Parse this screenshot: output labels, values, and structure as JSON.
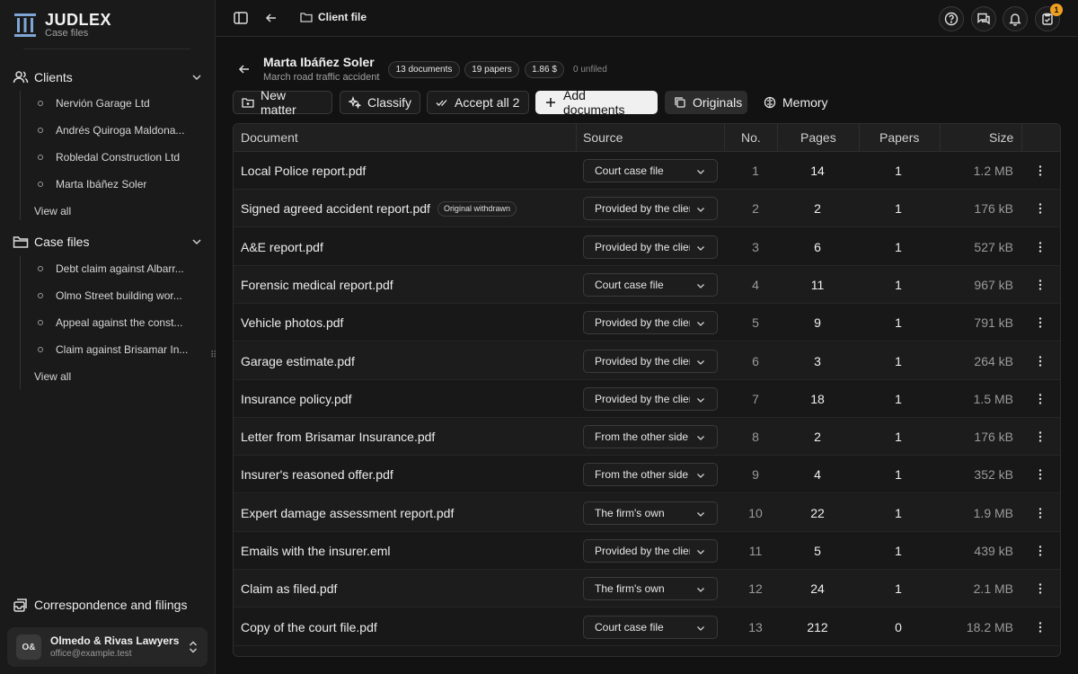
{
  "brand": {
    "title": "JUDLEX",
    "subtitle": "Case files"
  },
  "sidebar": {
    "clients": {
      "label": "Clients",
      "items": [
        "Nervión Garage Ltd",
        "Andrés Quiroga Maldona...",
        "Robledal Construction Ltd",
        "Marta Ibáñez Soler"
      ],
      "view_all": "View all"
    },
    "case_files": {
      "label": "Case files",
      "items": [
        "Debt claim against Albarr...",
        "Olmo Street building wor...",
        "Appeal against the const...",
        "Claim against Brisamar In..."
      ],
      "view_all": "View all"
    },
    "correspondence": "Correspondence and filings",
    "account": {
      "initials": "O&",
      "name": "Olmedo & Rivas Lawyers",
      "email": "office@example.test"
    }
  },
  "topbar": {
    "breadcrumb": "Client file",
    "notification_count": "1"
  },
  "client": {
    "name": "Marta Ibáñez Soler",
    "subtitle": "March road traffic accident",
    "pills": [
      "13 documents",
      "19 papers",
      "1.86 $"
    ],
    "unfiled": "0 unfiled"
  },
  "actions": {
    "new_matter": "New matter",
    "classify": "Classify",
    "accept_all": "Accept all 2",
    "add_documents": "Add documents",
    "originals": "Originals",
    "memory": "Memory"
  },
  "table": {
    "headers": {
      "document": "Document",
      "source": "Source",
      "no": "No.",
      "pages": "Pages",
      "papers": "Papers",
      "size": "Size"
    },
    "rows": [
      {
        "document": "Local Police report.pdf",
        "tag": "",
        "source": "Court case file",
        "no": "1",
        "pages": "14",
        "papers": "1",
        "size": "1.2 MB"
      },
      {
        "document": "Signed agreed accident report.pdf",
        "tag": "Original withdrawn",
        "source": "Provided by the client",
        "no": "2",
        "pages": "2",
        "papers": "1",
        "size": "176 kB"
      },
      {
        "document": "A&E report.pdf",
        "tag": "",
        "source": "Provided by the client",
        "no": "3",
        "pages": "6",
        "papers": "1",
        "size": "527 kB"
      },
      {
        "document": "Forensic medical report.pdf",
        "tag": "",
        "source": "Court case file",
        "no": "4",
        "pages": "11",
        "papers": "1",
        "size": "967 kB"
      },
      {
        "document": "Vehicle photos.pdf",
        "tag": "",
        "source": "Provided by the client",
        "no": "5",
        "pages": "9",
        "papers": "1",
        "size": "791 kB"
      },
      {
        "document": "Garage estimate.pdf",
        "tag": "",
        "source": "Provided by the client",
        "no": "6",
        "pages": "3",
        "papers": "1",
        "size": "264 kB"
      },
      {
        "document": "Insurance policy.pdf",
        "tag": "",
        "source": "Provided by the client",
        "no": "7",
        "pages": "18",
        "papers": "1",
        "size": "1.5 MB"
      },
      {
        "document": "Letter from Brisamar Insurance.pdf",
        "tag": "",
        "source": "From the other side",
        "no": "8",
        "pages": "2",
        "papers": "1",
        "size": "176 kB"
      },
      {
        "document": "Insurer's reasoned offer.pdf",
        "tag": "",
        "source": "From the other side",
        "no": "9",
        "pages": "4",
        "papers": "1",
        "size": "352 kB"
      },
      {
        "document": "Expert damage assessment report.pdf",
        "tag": "",
        "source": "The firm's own",
        "no": "10",
        "pages": "22",
        "papers": "1",
        "size": "1.9 MB"
      },
      {
        "document": "Emails with the insurer.eml",
        "tag": "",
        "source": "Provided by the client",
        "no": "11",
        "pages": "5",
        "papers": "1",
        "size": "439 kB"
      },
      {
        "document": "Claim as filed.pdf",
        "tag": "",
        "source": "The firm's own",
        "no": "12",
        "pages": "24",
        "papers": "1",
        "size": "2.1 MB"
      },
      {
        "document": "Copy of the court file.pdf",
        "tag": "",
        "source": "Court case file",
        "no": "13",
        "pages": "212",
        "papers": "0",
        "size": "18.2 MB"
      }
    ]
  }
}
